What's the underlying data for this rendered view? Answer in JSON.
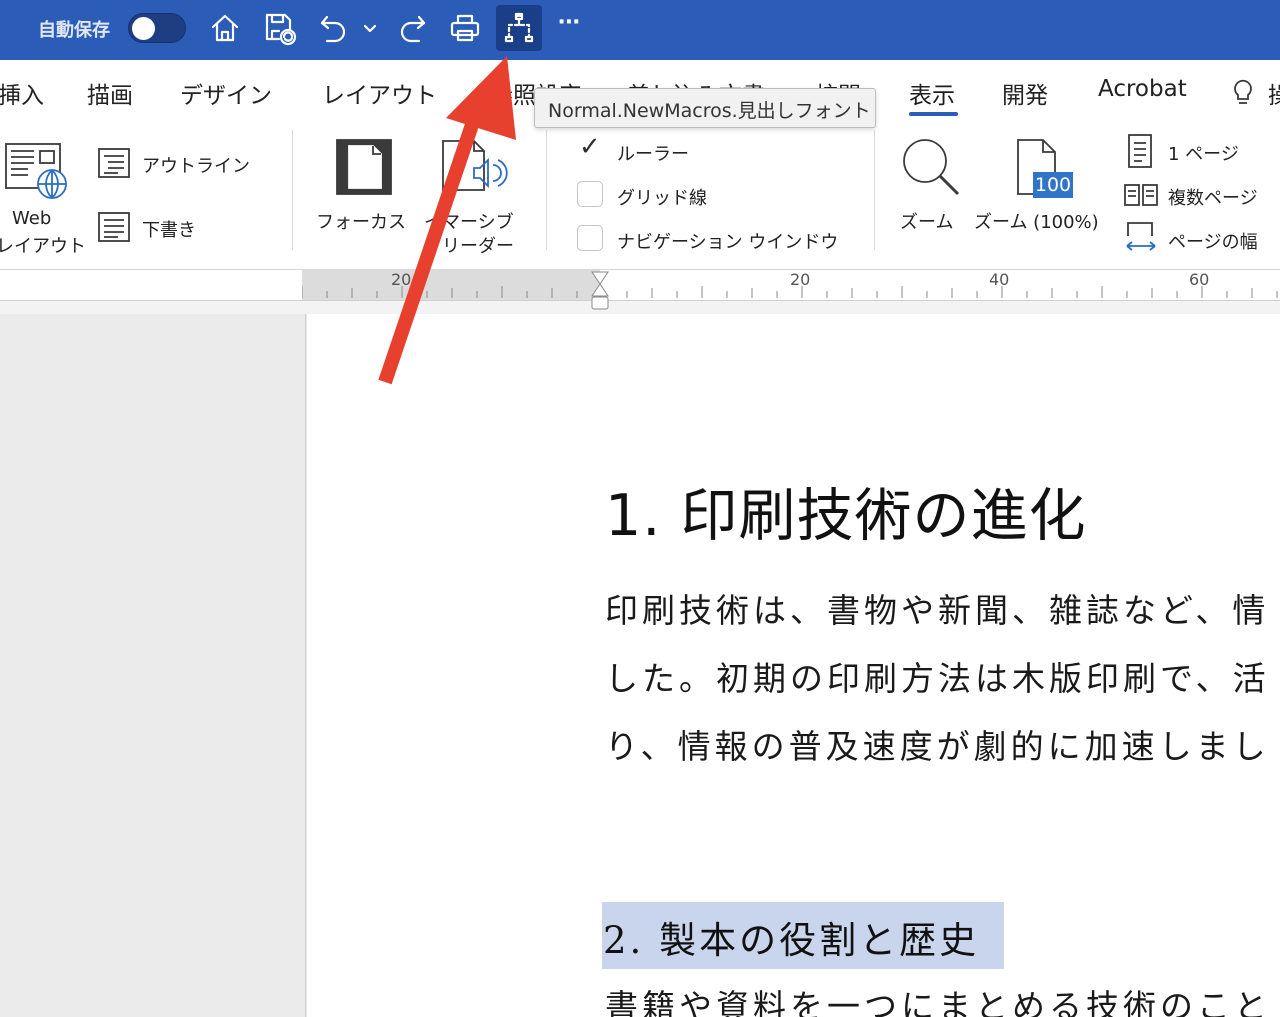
{
  "titlebar": {
    "autosave_label": "自動保存",
    "icons": [
      "home-icon",
      "save-sync-icon",
      "undo-icon",
      "chevron-down-icon",
      "redo-icon",
      "print-icon",
      "macro-icon",
      "more-icon"
    ],
    "more": "⋯"
  },
  "tabs": [
    "挿入",
    "描画",
    "デザイン",
    "レイアウト",
    "参照設定",
    "差し込み文書",
    "校閲",
    "表示",
    "開発",
    "Acrobat",
    "操作"
  ],
  "active_tab": "表示",
  "tooltip": "Normal.NewMacros.見出しフォント",
  "ribbon": {
    "web_layout": "Web\nレイアウト",
    "web_layout_l1": "Web",
    "web_layout_l2": "レイアウト",
    "outline": "アウトライン",
    "draft": "下書き",
    "focus": "フォーカス",
    "immersive_l1": "イマーシブ",
    "immersive_l2": "リーダー",
    "ruler": "ルーラー",
    "ruler_checked": true,
    "gridlines": "グリッド線",
    "nav_pane": "ナビゲーション ウインドウ",
    "zoom": "ズーム",
    "zoom100": "ズーム (100%)",
    "zoom100_badge": "100",
    "one_page": "1 ページ",
    "multi_page": "複数ページ",
    "page_width": "ページの幅"
  },
  "ruler": {
    "labels": [
      "20",
      "20",
      "40",
      "60"
    ]
  },
  "document": {
    "heading1": "1.  印刷技術の進化",
    "paragraph1": [
      "印刷技術は、書物や新聞、雑誌など、情",
      "した。初期の印刷方法は木版印刷で、活",
      "り、情報の普及速度が劇的に加速しまし"
    ],
    "heading2": "2. 製本の役割と歴史",
    "paragraph2": "書籍や資料を一つにまとめる技術のこと"
  },
  "colors": {
    "titlebar": "#2b5cb8",
    "highlight": "#c9d5ec",
    "arrow": "#e8402e"
  }
}
